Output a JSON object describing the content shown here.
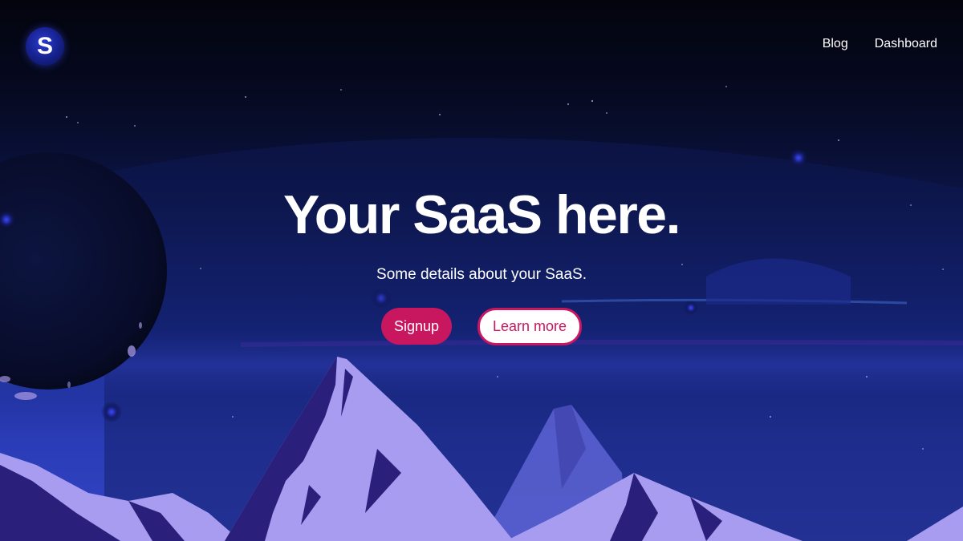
{
  "brand": {
    "logo_letter": "S",
    "accent_color": "#c8175f"
  },
  "nav": {
    "items": [
      {
        "label": "Blog"
      },
      {
        "label": "Dashboard"
      }
    ]
  },
  "hero": {
    "title": "Your SaaS here.",
    "subtitle": "Some details about your SaaS.",
    "primary_button": "Signup",
    "secondary_button": "Learn more"
  },
  "background": {
    "scene": "night-sky-mountains-illustration",
    "colors": {
      "sky_top": "#03040d",
      "sky_bottom": "#3344c4",
      "mountain_light": "#a79cf0",
      "mountain_dark": "#2a1f7a"
    }
  }
}
